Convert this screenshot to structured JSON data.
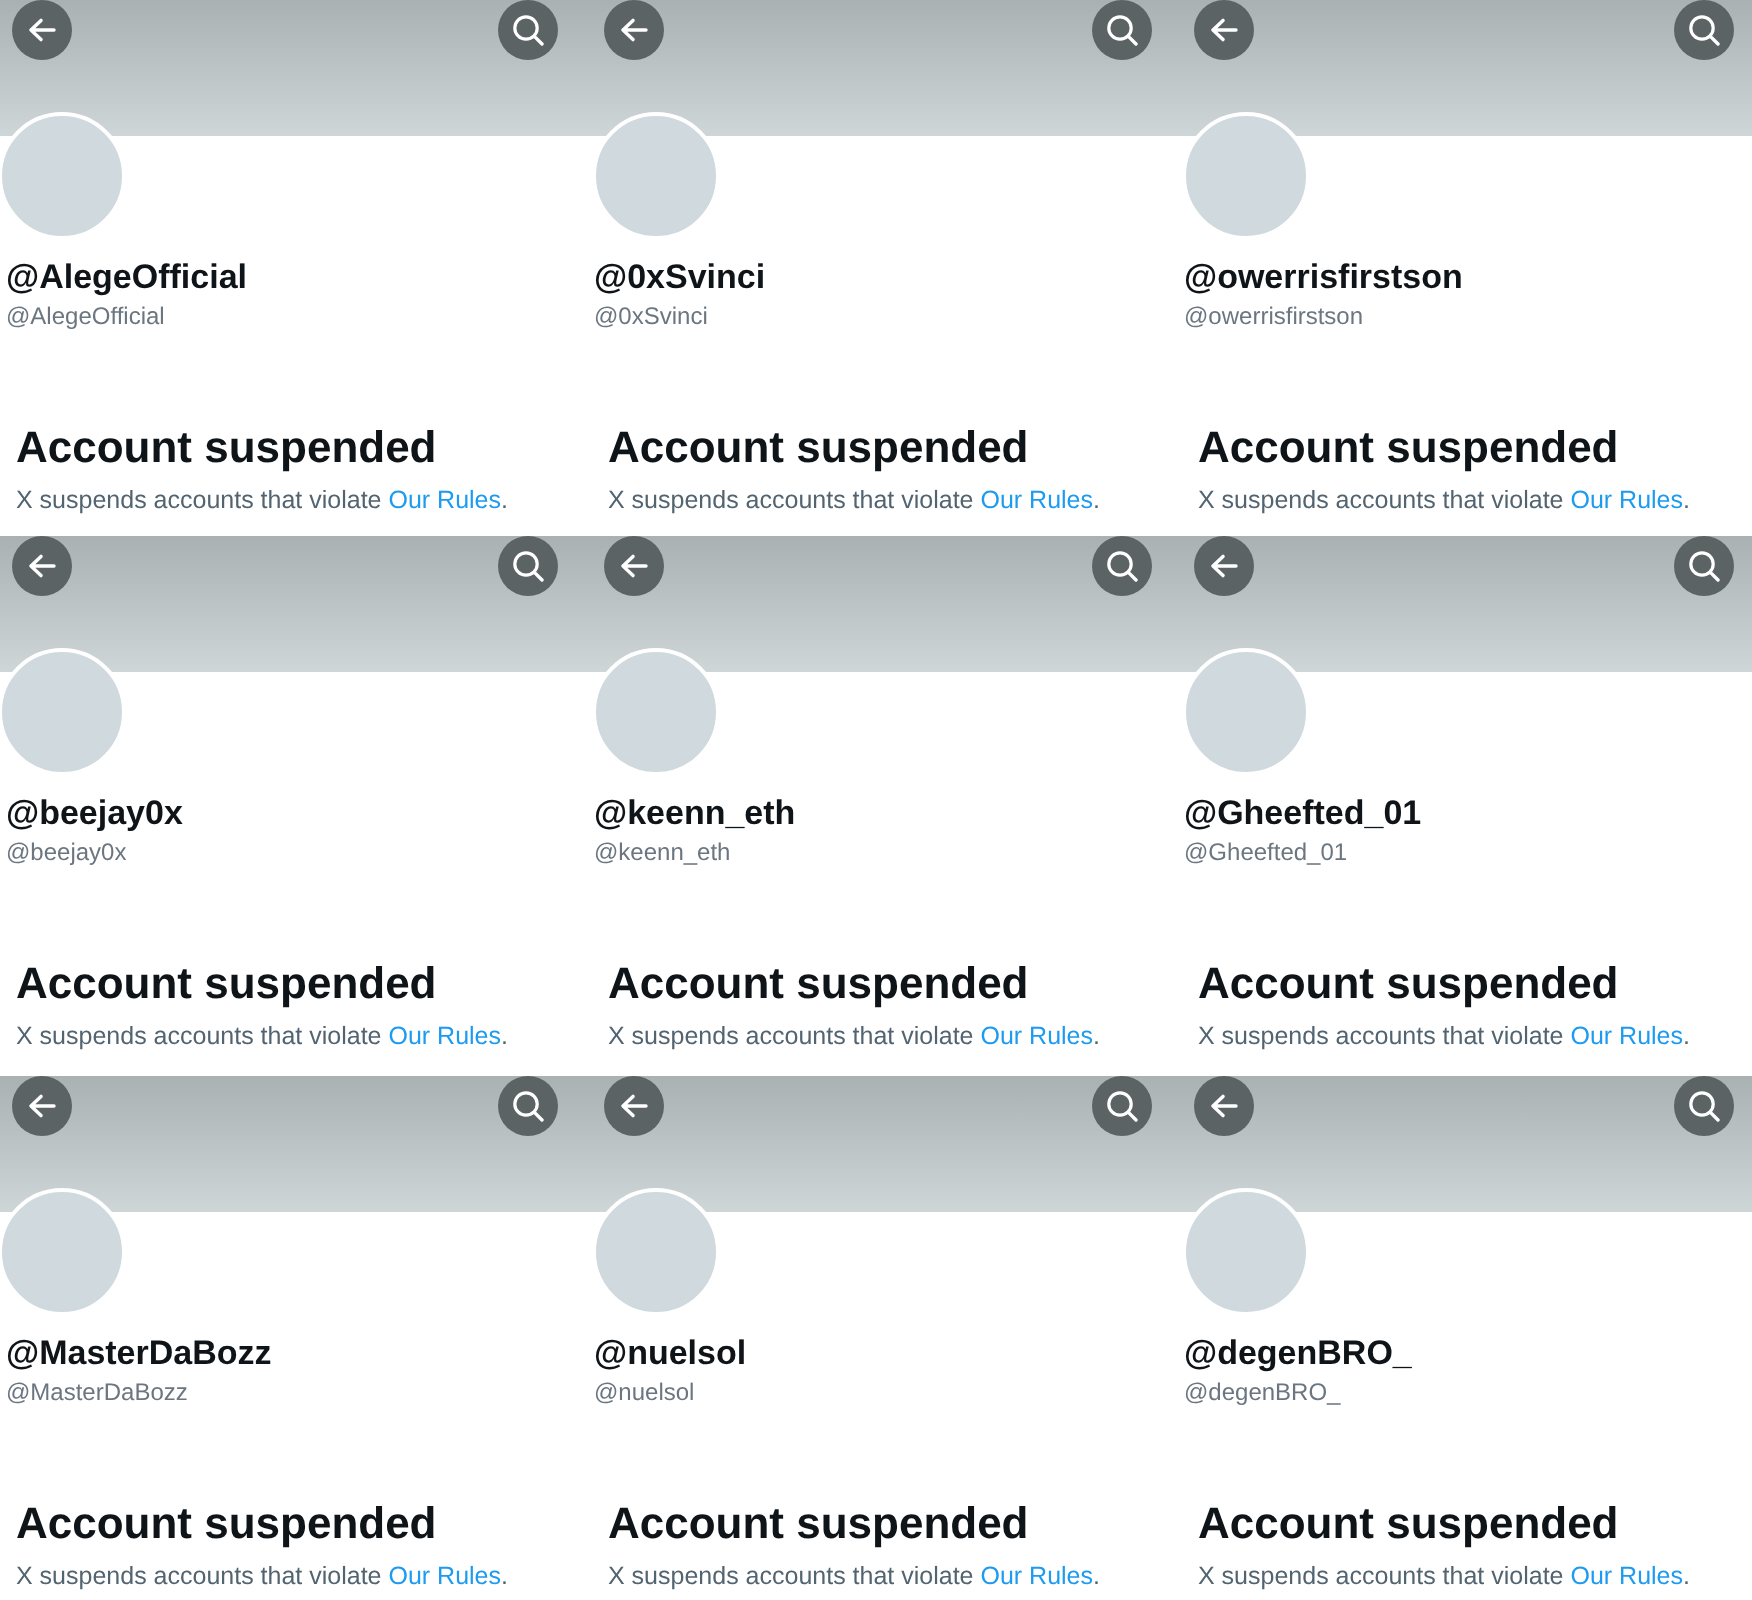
{
  "profiles": [
    {
      "display_name": "@AlegeOfficial",
      "handle": "@AlegeOfficial",
      "heading": "Account suspended",
      "message": "X suspends accounts that violate ",
      "link": "Our Rules",
      "message_end": "."
    },
    {
      "display_name": "@0xSvinci",
      "handle": "@0xSvinci",
      "heading": "Account suspended",
      "message": "X suspends accounts that violate ",
      "link": "Our Rules",
      "message_end": "."
    },
    {
      "display_name": "@owerrisfirstson",
      "handle": "@owerrisfirstson",
      "heading": "Account suspended",
      "message": "X suspends accounts that violate ",
      "link": "Our Rules",
      "message_end": "."
    },
    {
      "display_name": "@beejay0x",
      "handle": "@beejay0x",
      "heading": "Account suspended",
      "message": "X suspends accounts that violate ",
      "link": "Our Rules",
      "message_end": "."
    },
    {
      "display_name": "@keenn_eth",
      "handle": "@keenn_eth",
      "heading": "Account suspended",
      "message": "X suspends accounts that violate ",
      "link": "Our Rules",
      "message_end": "."
    },
    {
      "display_name": "@Gheefted_01",
      "handle": "@Gheefted_01",
      "heading": "Account suspended",
      "message": "X suspends accounts that violate ",
      "link": "Our Rules",
      "message_end": "."
    },
    {
      "display_name": "@MasterDaBozz",
      "handle": "@MasterDaBozz",
      "heading": "Account suspended",
      "message": "X suspends accounts that violate ",
      "link": "Our Rules",
      "message_end": "."
    },
    {
      "display_name": "@nuelsol",
      "handle": "@nuelsol",
      "heading": "Account suspended",
      "message": "X suspends accounts that violate ",
      "link": "Our Rules",
      "message_end": "."
    },
    {
      "display_name": "@degenBRO_",
      "handle": "@degenBRO_",
      "heading": "Account suspended",
      "message": "X suspends accounts that violate ",
      "link": "Our Rules",
      "message_end": "."
    }
  ]
}
